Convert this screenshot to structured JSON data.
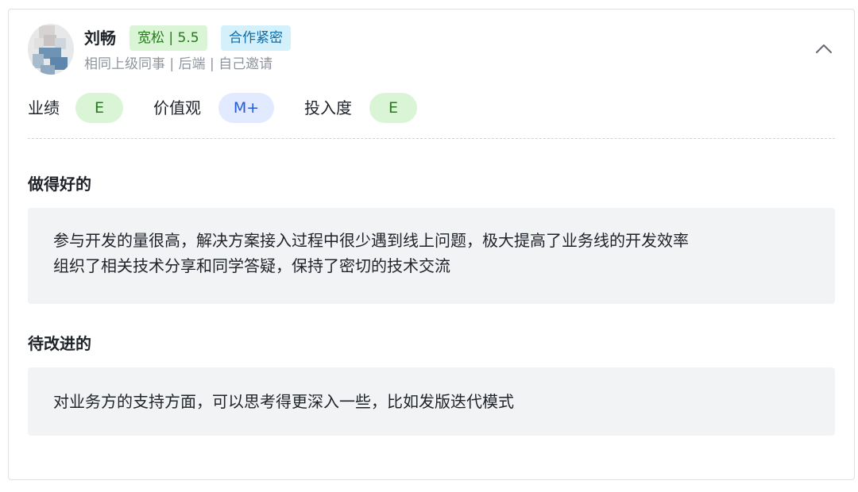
{
  "person": {
    "name": "刘畅",
    "level_tag": "宽松 | 5.5",
    "relation_tag": "合作紧密",
    "meta": "相同上级同事 | 后端 | 自己邀请",
    "avatar_icon": "user-avatar"
  },
  "ratings": [
    {
      "label": "业绩",
      "grade": "E"
    },
    {
      "label": "价值观",
      "grade": "M+"
    },
    {
      "label": "投入度",
      "grade": "E"
    }
  ],
  "sections": {
    "good": {
      "title": "做得好的",
      "lines": [
        "参与开发的量很高，解决方案接入过程中很少遇到线上问题，极大提高了业务线的开发效率",
        "组织了相关技术分享和同学答疑，保持了密切的技术交流"
      ]
    },
    "improve": {
      "title": "待改进的",
      "lines": [
        "对业务方的支持方面，可以思考得更深入一些，比如发版迭代模式"
      ]
    }
  },
  "collapse_icon": "chevron-up-icon",
  "colors": {
    "green_tag_bg": "#d9f5d6",
    "green_tag_text": "#237b19",
    "blue_tag_bg": "#d4f1fb",
    "blue_tag_text": "#0e6ba8",
    "mplus_bg": "#e1eaff",
    "mplus_text": "#245bdb"
  }
}
